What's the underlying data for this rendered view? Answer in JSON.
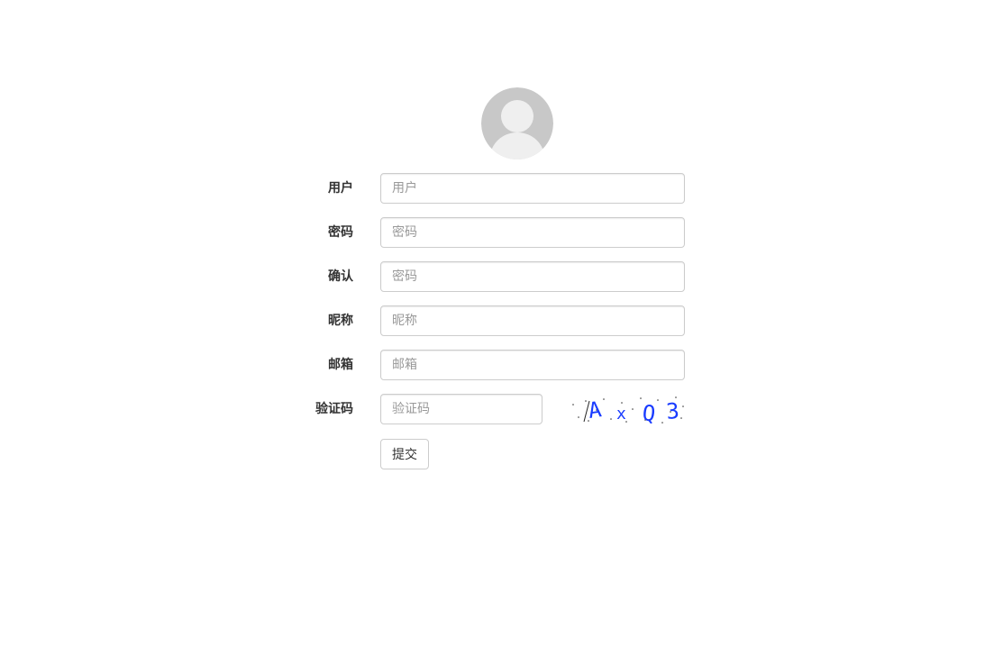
{
  "avatar": {
    "icon": "user-avatar-icon",
    "bg_color": "#c8c8c8",
    "fg_color": "#efefef"
  },
  "form": {
    "username": {
      "label": "用户",
      "placeholder": "用户",
      "value": ""
    },
    "password": {
      "label": "密码",
      "placeholder": "密码",
      "value": ""
    },
    "confirm": {
      "label": "确认",
      "placeholder": "密码",
      "value": ""
    },
    "nickname": {
      "label": "昵称",
      "placeholder": "昵称",
      "value": ""
    },
    "email": {
      "label": "邮箱",
      "placeholder": "邮箱",
      "value": ""
    },
    "captcha": {
      "label": "验证码",
      "placeholder": "验证码",
      "value": "",
      "image_text": "AxQ3",
      "image_color": "#1a3cff"
    },
    "submit_label": "提交"
  }
}
